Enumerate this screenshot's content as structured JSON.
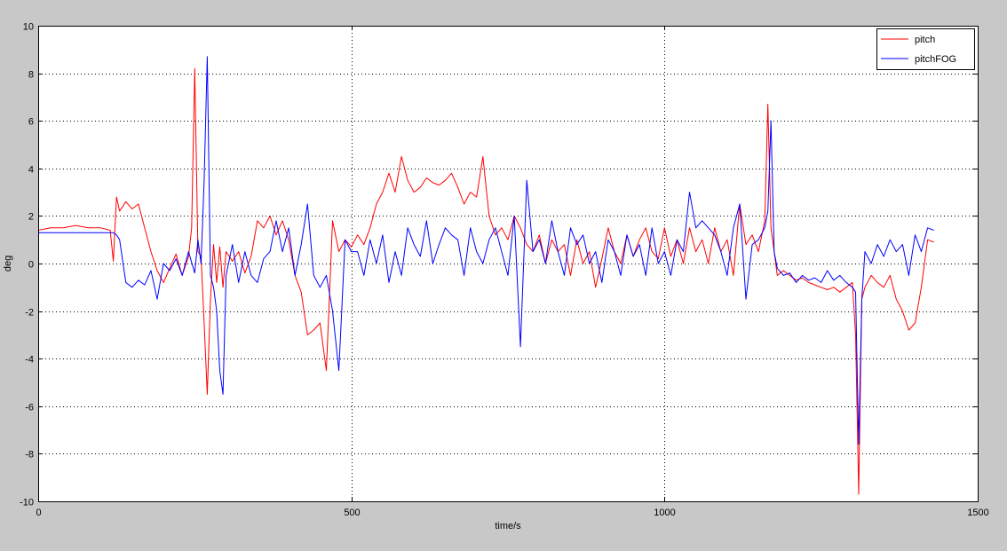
{
  "colors": {
    "figure_background": "#c8c8c8",
    "axes_background": "#ffffff",
    "pitch": "#ff0000",
    "pitchFOG": "#0000ff"
  },
  "chart_data": {
    "type": "line",
    "title": "",
    "xlabel": "time/s",
    "ylabel": "deg",
    "xlim": [
      0,
      1500
    ],
    "ylim": [
      -10,
      10
    ],
    "xticks": [
      0,
      500,
      1000,
      1500
    ],
    "yticks": [
      -10,
      -8,
      -6,
      -4,
      -2,
      0,
      2,
      4,
      6,
      8,
      10
    ],
    "grid": true,
    "legend": {
      "placement": "top-right",
      "entries": [
        "pitch",
        "pitchFOG"
      ]
    },
    "series": [
      {
        "name": "pitch",
        "color": "#ff0000",
        "x": [
          0,
          20,
          40,
          60,
          80,
          100,
          115,
          120,
          125,
          130,
          140,
          150,
          160,
          170,
          180,
          190,
          200,
          210,
          220,
          230,
          240,
          245,
          250,
          255,
          260,
          265,
          270,
          275,
          280,
          285,
          290,
          295,
          300,
          310,
          320,
          330,
          340,
          350,
          360,
          370,
          380,
          390,
          400,
          410,
          420,
          430,
          440,
          450,
          460,
          470,
          480,
          490,
          500,
          510,
          520,
          530,
          540,
          550,
          560,
          570,
          580,
          590,
          600,
          610,
          620,
          630,
          640,
          650,
          660,
          670,
          680,
          690,
          700,
          710,
          720,
          730,
          740,
          750,
          760,
          770,
          780,
          790,
          800,
          810,
          820,
          830,
          840,
          850,
          860,
          870,
          880,
          890,
          900,
          910,
          920,
          930,
          940,
          950,
          960,
          970,
          980,
          990,
          1000,
          1010,
          1020,
          1030,
          1040,
          1050,
          1060,
          1070,
          1080,
          1090,
          1100,
          1110,
          1120,
          1130,
          1140,
          1150,
          1160,
          1165,
          1170,
          1175,
          1180,
          1190,
          1200,
          1210,
          1220,
          1230,
          1240,
          1250,
          1260,
          1270,
          1280,
          1290,
          1300,
          1305,
          1310,
          1315,
          1320,
          1330,
          1340,
          1350,
          1360,
          1370,
          1380,
          1390,
          1400,
          1410,
          1420,
          1430
        ],
        "y": [
          1.4,
          1.5,
          1.5,
          1.6,
          1.5,
          1.5,
          1.4,
          0.1,
          2.8,
          2.2,
          2.6,
          2.3,
          2.5,
          1.5,
          0.5,
          -0.3,
          -0.8,
          -0.2,
          0.4,
          -0.5,
          0.3,
          1.5,
          8.2,
          0.5,
          0.3,
          -2.5,
          -5.5,
          -1.5,
          0.8,
          -0.8,
          0.7,
          -1.0,
          0.5,
          0.1,
          0.5,
          -0.4,
          0.3,
          1.8,
          1.5,
          2.0,
          1.2,
          1.8,
          1.0,
          -0.5,
          -1.2,
          -3.0,
          -2.8,
          -2.5,
          -4.5,
          1.8,
          0.5,
          1.0,
          0.7,
          1.2,
          0.8,
          1.5,
          2.5,
          3.0,
          3.8,
          3.0,
          4.5,
          3.5,
          3.0,
          3.2,
          3.6,
          3.4,
          3.3,
          3.5,
          3.8,
          3.2,
          2.5,
          3.0,
          2.8,
          4.5,
          2.0,
          1.2,
          1.5,
          1.0,
          2.0,
          1.5,
          0.8,
          0.5,
          1.2,
          0.0,
          1.0,
          0.5,
          0.8,
          -0.5,
          1.0,
          0.0,
          0.5,
          -1.0,
          0.2,
          1.5,
          0.5,
          0.0,
          1.2,
          0.3,
          1.0,
          1.5,
          0.5,
          0.2,
          1.5,
          0.3,
          1.0,
          0.0,
          1.5,
          0.5,
          1.0,
          0.0,
          1.5,
          0.5,
          1.0,
          -0.5,
          2.5,
          0.8,
          1.2,
          0.5,
          1.8,
          6.7,
          1.5,
          0.5,
          -0.5,
          -0.3,
          -0.5,
          -0.7,
          -0.6,
          -0.8,
          -0.9,
          -1.0,
          -1.1,
          -1.0,
          -1.2,
          -1.0,
          -0.8,
          -3.0,
          -9.7,
          -1.5,
          -1.0,
          -0.5,
          -0.8,
          -1.0,
          -0.5,
          -1.5,
          -2.0,
          -2.8,
          -2.5,
          -1.0,
          1.0,
          0.9
        ]
      },
      {
        "name": "pitchFOG",
        "color": "#0000ff",
        "x": [
          0,
          20,
          40,
          60,
          80,
          100,
          115,
          120,
          125,
          130,
          140,
          150,
          160,
          170,
          180,
          190,
          200,
          210,
          220,
          230,
          240,
          250,
          255,
          260,
          265,
          270,
          275,
          280,
          285,
          290,
          295,
          300,
          310,
          320,
          330,
          340,
          350,
          360,
          370,
          380,
          390,
          400,
          410,
          420,
          430,
          440,
          450,
          460,
          470,
          480,
          490,
          500,
          510,
          520,
          530,
          540,
          550,
          560,
          570,
          580,
          590,
          600,
          610,
          620,
          630,
          640,
          650,
          660,
          670,
          680,
          690,
          700,
          710,
          720,
          730,
          740,
          750,
          760,
          770,
          780,
          790,
          800,
          810,
          820,
          830,
          840,
          850,
          860,
          870,
          880,
          890,
          900,
          910,
          920,
          930,
          940,
          950,
          960,
          970,
          980,
          990,
          1000,
          1010,
          1020,
          1030,
          1040,
          1050,
          1060,
          1070,
          1080,
          1090,
          1100,
          1110,
          1120,
          1130,
          1140,
          1150,
          1160,
          1165,
          1170,
          1175,
          1180,
          1190,
          1200,
          1210,
          1220,
          1230,
          1240,
          1250,
          1260,
          1270,
          1280,
          1290,
          1300,
          1305,
          1310,
          1315,
          1320,
          1330,
          1340,
          1350,
          1360,
          1370,
          1380,
          1390,
          1400,
          1410,
          1420,
          1430
        ],
        "y": [
          1.3,
          1.3,
          1.3,
          1.3,
          1.3,
          1.3,
          1.3,
          1.3,
          1.2,
          1.0,
          -0.8,
          -1.0,
          -0.7,
          -0.9,
          -0.3,
          -1.5,
          0.0,
          -0.3,
          0.2,
          -0.5,
          0.5,
          -0.4,
          1.0,
          0.0,
          3.5,
          8.7,
          -0.5,
          -1.0,
          -2.0,
          -4.5,
          -5.5,
          -0.5,
          0.8,
          -0.8,
          0.5,
          -0.5,
          -0.8,
          0.2,
          0.5,
          1.8,
          0.5,
          1.5,
          -0.5,
          0.8,
          2.5,
          -0.5,
          -1.0,
          -0.5,
          -2.0,
          -4.5,
          1.0,
          0.5,
          0.5,
          -0.5,
          1.0,
          0.0,
          1.2,
          -0.8,
          0.5,
          -0.5,
          1.5,
          0.8,
          0.3,
          1.8,
          0.0,
          0.8,
          1.5,
          1.2,
          1.0,
          -0.5,
          1.5,
          0.5,
          0.0,
          1.0,
          1.5,
          0.5,
          -0.5,
          2.0,
          -3.5,
          3.5,
          0.5,
          1.0,
          0.0,
          1.8,
          0.5,
          -0.5,
          1.5,
          0.8,
          1.2,
          0.0,
          0.5,
          -0.8,
          1.0,
          0.5,
          -0.5,
          1.2,
          0.3,
          0.8,
          -0.5,
          1.5,
          0.0,
          0.5,
          -0.5,
          1.0,
          0.5,
          3.0,
          1.5,
          1.8,
          1.5,
          1.2,
          0.5,
          -0.5,
          1.5,
          2.5,
          -1.5,
          0.8,
          1.0,
          1.5,
          2.2,
          6.0,
          0.5,
          -0.2,
          -0.5,
          -0.4,
          -0.8,
          -0.5,
          -0.7,
          -0.6,
          -0.8,
          -0.3,
          -0.7,
          -0.5,
          -0.8,
          -1.0,
          -1.2,
          -7.6,
          -1.5,
          0.5,
          0.0,
          0.8,
          0.3,
          1.0,
          0.5,
          0.8,
          -0.5,
          1.2,
          0.5,
          1.5,
          1.4
        ]
      }
    ]
  }
}
